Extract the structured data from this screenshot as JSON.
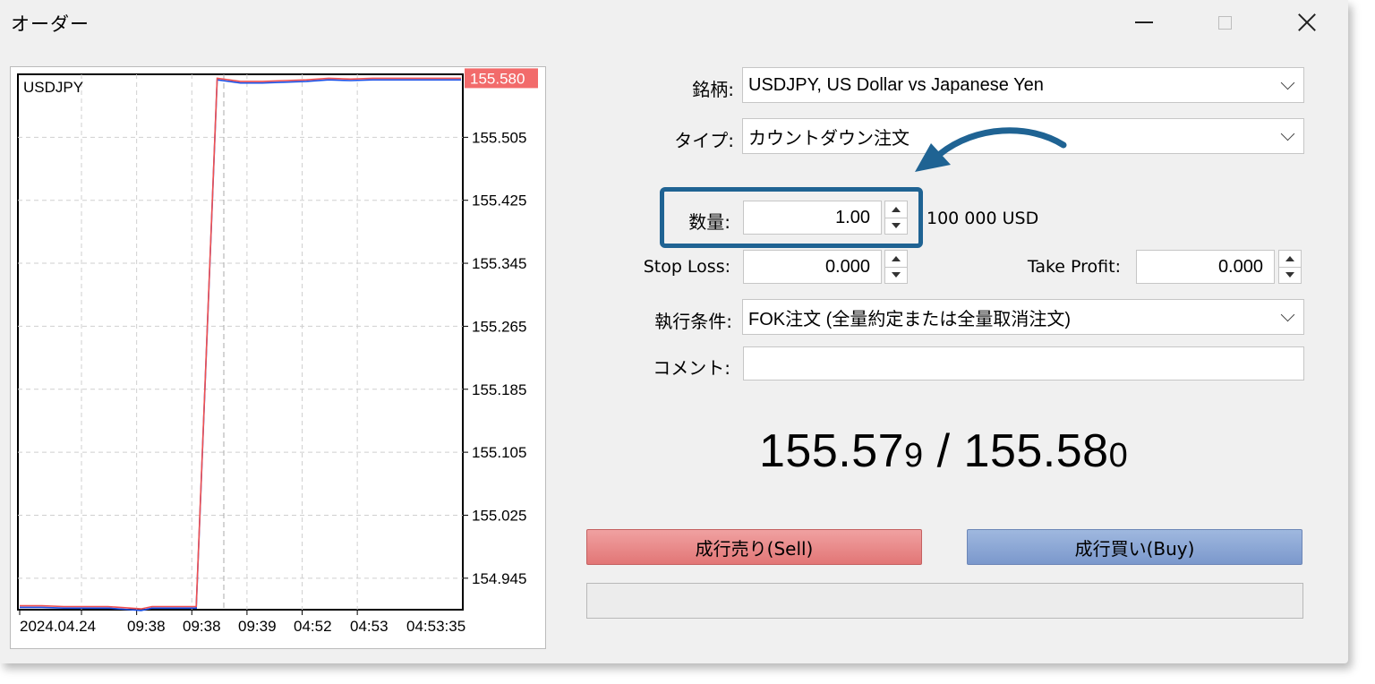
{
  "window": {
    "title": "オーダー",
    "icons": {
      "minimize": "minimize-icon",
      "maximize": "maximize-icon",
      "close": "close-icon"
    }
  },
  "chart": {
    "symbol_label": "USDJPY",
    "current_price_tag": "155.580",
    "price_tag_color": "#f26b6b",
    "bid_color": "#1a4fe6",
    "ask_color": "#f05050"
  },
  "chart_data": {
    "type": "line",
    "title": "USDJPY",
    "xlabel": "",
    "ylabel": "",
    "x_ticks": [
      "2024.04.24",
      "09:38",
      "09:38",
      "09:39",
      "04:52",
      "04:53",
      "04:53:35"
    ],
    "y_ticks": [
      155.505,
      155.425,
      155.345,
      155.265,
      155.185,
      155.105,
      155.025,
      154.945
    ],
    "y_tick_labels": [
      "155.505",
      "155.425",
      "155.345",
      "155.265",
      "155.185",
      "155.105",
      "155.025",
      "154.945"
    ],
    "ylim": [
      154.905,
      155.585
    ],
    "grid": true,
    "series": [
      {
        "name": "",
        "color": "#1a4fe6",
        "x": [
          0,
          1,
          2,
          3,
          4,
          5,
          5.5,
          6,
          7,
          8,
          9,
          10,
          11,
          12,
          13,
          14,
          15,
          16,
          17,
          18,
          19,
          20
        ],
        "values": [
          154.908,
          154.908,
          154.907,
          154.907,
          154.907,
          154.905,
          154.904,
          154.907,
          154.907,
          154.907,
          155.578,
          155.574,
          155.574,
          155.575,
          155.576,
          155.578,
          155.577,
          155.578,
          155.578,
          155.578,
          155.578,
          155.578
        ]
      },
      {
        "name": "",
        "color": "#f05050",
        "x": [
          0,
          1,
          2,
          3,
          4,
          5,
          5.5,
          6,
          7,
          8,
          9,
          10,
          11,
          12,
          13,
          14,
          15,
          16,
          17,
          18,
          19,
          20
        ],
        "values": [
          154.91,
          154.91,
          154.909,
          154.909,
          154.909,
          154.907,
          154.906,
          154.909,
          154.909,
          154.909,
          155.58,
          155.576,
          155.576,
          155.577,
          155.578,
          155.58,
          155.579,
          155.58,
          155.58,
          155.58,
          155.58,
          155.58
        ]
      }
    ],
    "annotations": [
      "155.580"
    ]
  },
  "form": {
    "symbol_label": "銘柄:",
    "symbol_value": "USDJPY, US Dollar vs Japanese Yen",
    "type_label": "タイプ:",
    "type_value": "カウントダウン注文",
    "volume_label": "数量:",
    "volume_value": "1.00",
    "volume_note": "100 000 USD",
    "sl_label": "Stop Loss:",
    "sl_value": "0.000",
    "tp_label": "Take Profit:",
    "tp_value": "0.000",
    "fill_label": "執行条件:",
    "fill_value": "FOK注文 (全量約定または全量取消注文)",
    "comment_label": "コメント:",
    "comment_value": ""
  },
  "price": {
    "bid_main": "155.57",
    "bid_last": "9",
    "separator": " / ",
    "ask_main": "155.58",
    "ask_last": "0"
  },
  "buttons": {
    "sell_label": "成行売り(Sell)",
    "buy_label": "成行買い(Buy)"
  },
  "annotation": {
    "highlight_color": "#1f6393",
    "arrow_color": "#1f6393"
  }
}
